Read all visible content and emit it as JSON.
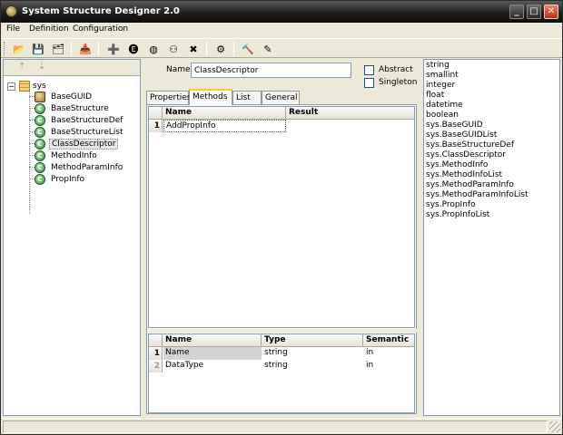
{
  "window": {
    "title": "System Structure Designer 2.0",
    "minimize_glyph": "_",
    "maximize_glyph": "□",
    "close_glyph": "✕"
  },
  "menu": [
    "File",
    "Definition",
    "Configuration"
  ],
  "toolbar": [
    {
      "icon": "open-folder-icon",
      "glyph": "📂"
    },
    {
      "icon": "save-icon",
      "glyph": "💾"
    },
    {
      "icon": "save-all-icon",
      "glyph": "🗂"
    },
    {
      "icon": "import-icon",
      "glyph": "📥"
    },
    {
      "icon": "add-class-icon",
      "glyph": "➕"
    },
    {
      "icon": "add-enum-icon",
      "glyph": "🅔"
    },
    {
      "icon": "add-interface-icon",
      "glyph": "◍"
    },
    {
      "icon": "structure-icon",
      "glyph": "⚇"
    },
    {
      "icon": "delete-icon",
      "glyph": "✖"
    },
    {
      "icon": "generate-icon",
      "glyph": "⚙"
    },
    {
      "icon": "build-icon",
      "glyph": "🔨"
    },
    {
      "icon": "clear-icon",
      "glyph": "✎"
    }
  ],
  "tree": {
    "root_label": "sys",
    "expander_glyph": "−",
    "nodes": [
      {
        "label": "BaseGUID",
        "kind": "struct",
        "badge": ""
      },
      {
        "label": "BaseStructure",
        "kind": "class",
        "badge": "C"
      },
      {
        "label": "BaseStructureDef",
        "kind": "class",
        "badge": "C"
      },
      {
        "label": "BaseStructureList",
        "kind": "class",
        "badge": "C"
      },
      {
        "label": "ClassDescriptor",
        "kind": "class",
        "badge": "C",
        "selected": true
      },
      {
        "label": "MethodInfo",
        "kind": "class",
        "badge": "C"
      },
      {
        "label": "MethodParamInfo",
        "kind": "class",
        "badge": "C"
      },
      {
        "label": "PropInfo",
        "kind": "class",
        "badge": "C"
      }
    ]
  },
  "editor": {
    "name_label": "Name",
    "name_value": "ClassDescriptor",
    "abstract_label": "Abstract",
    "singleton_label": "Singleton",
    "tabs": [
      "Properties",
      "Methods",
      "List",
      "General"
    ],
    "active_tab": "Methods"
  },
  "methods_grid": {
    "columns": [
      "Name",
      "Result"
    ],
    "rows": [
      {
        "num": "1",
        "name": "AddPropInfo",
        "result": ""
      }
    ]
  },
  "params_grid": {
    "columns": [
      "Name",
      "Type",
      "Semantic"
    ],
    "rows": [
      {
        "num": "1",
        "name": "Name",
        "type": "string",
        "semantic": "in"
      },
      {
        "num": "2",
        "name": "DataType",
        "type": "string",
        "semantic": "in"
      }
    ]
  },
  "types_list": [
    "string",
    "smallint",
    "integer",
    "float",
    "datetime",
    "boolean",
    "sys.BaseGUID",
    "sys.BaseGUIDList",
    "sys.BaseStructureDef",
    "sys.ClassDescriptor",
    "sys.MethodInfo",
    "sys.MethodInfoList",
    "sys.MethodParamInfo",
    "sys.MethodParamInfoList",
    "sys.PropInfo",
    "sys.PropInfoList"
  ]
}
